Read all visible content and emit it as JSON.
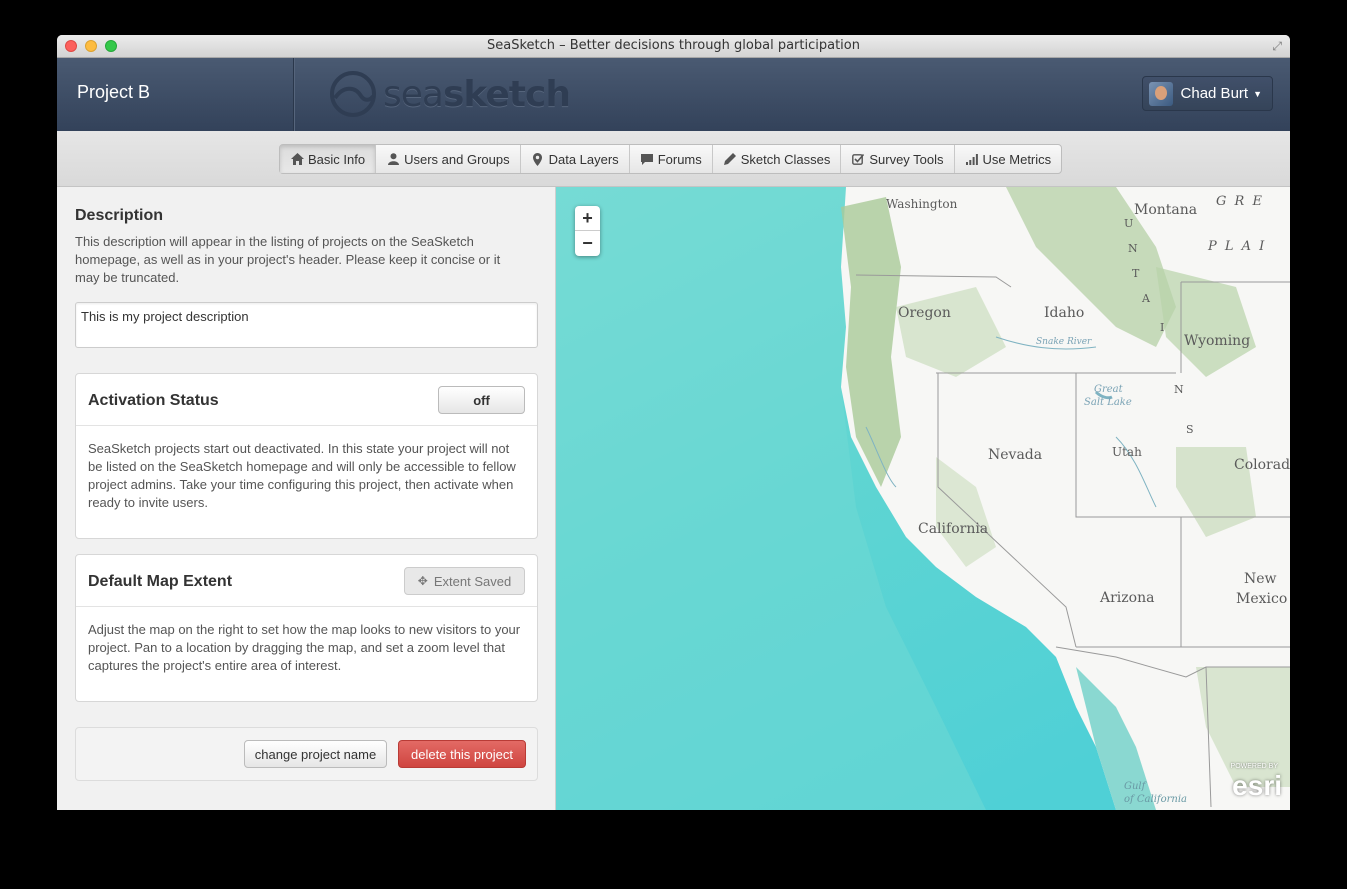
{
  "window": {
    "title": "SeaSketch – Better decisions through global participation"
  },
  "header": {
    "project_name": "Project B",
    "logo_text_light": "sea",
    "logo_text_bold": "sketch",
    "user_name": "Chad Burt"
  },
  "nav": {
    "tabs": [
      {
        "label": "Basic Info",
        "icon": "home-icon"
      },
      {
        "label": "Users and Groups",
        "icon": "user-icon"
      },
      {
        "label": "Data Layers",
        "icon": "map-marker-icon"
      },
      {
        "label": "Forums",
        "icon": "comment-icon"
      },
      {
        "label": "Sketch Classes",
        "icon": "pencil-icon"
      },
      {
        "label": "Survey Tools",
        "icon": "check-icon"
      },
      {
        "label": "Use Metrics",
        "icon": "signal-icon"
      }
    ],
    "active": "Basic Info"
  },
  "description": {
    "title": "Description",
    "help": "This description will appear in the listing of projects on the SeaSketch homepage, as well as in your project's header. Please keep it concise or it may be truncated.",
    "value": "This is my project description"
  },
  "activation": {
    "title": "Activation Status",
    "button": "off",
    "body": "SeaSketch projects start out deactivated. In this state your project will not be listed on the SeaSketch homepage and will only be accessible to fellow project admins. Take your time configuring this project, then activate when ready to invite users."
  },
  "extent": {
    "title": "Default Map Extent",
    "button": "Extent Saved",
    "body": "Adjust the map on the right to set how the map looks to new visitors to your project. Pan to a location by dragging the map, and set a zoom level that captures the project's entire area of interest."
  },
  "actions": {
    "change_name": "change project name",
    "delete": "delete this project"
  },
  "map": {
    "zoom_in": "+",
    "zoom_out": "−",
    "labels": {
      "washington": "Washington",
      "montana": "Montana",
      "oregon": "Oregon",
      "idaho": "Idaho",
      "wyoming": "Wyoming",
      "nevada": "Nevada",
      "utah": "Utah",
      "colorado": "Colorad",
      "california": "California",
      "arizona": "Arizona",
      "new_mexico_1": "New",
      "new_mexico_2": "Mexico",
      "great_salt_lake_1": "Great",
      "great_salt_lake_2": "Salt Lake",
      "snake_river": "Snake River",
      "gulf_1": "Gulf",
      "gulf_2": "of California",
      "gre": "G R E",
      "plai": "P L A I",
      "mountains_1": "U",
      "mountains_2": "N",
      "mountains_3": "T",
      "mountains_4": "A",
      "mountains_5": "I",
      "mountains_6": "N",
      "mountains_7": "S"
    },
    "attribution_small": "POWERED BY",
    "attribution": "esri"
  }
}
